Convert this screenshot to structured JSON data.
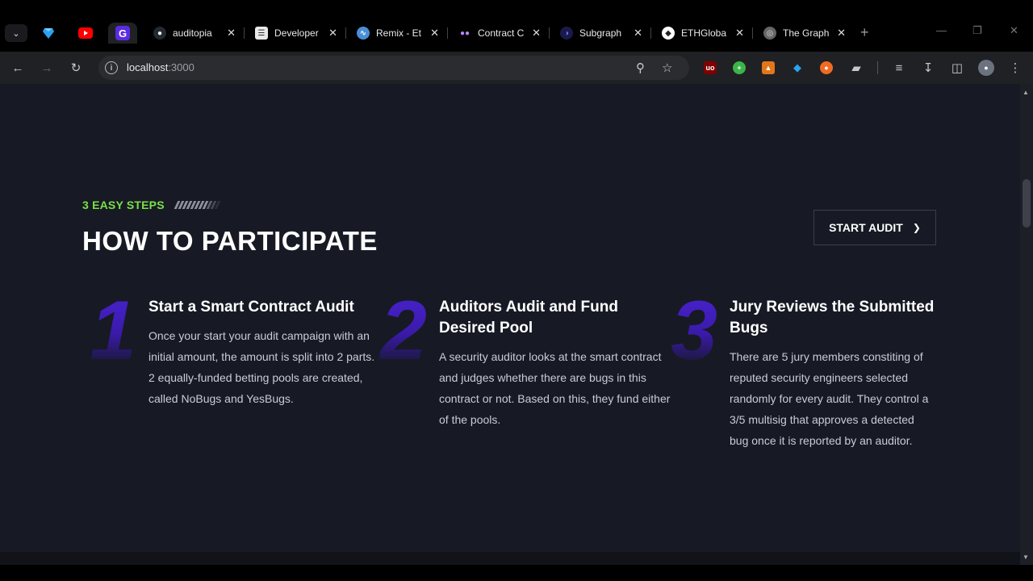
{
  "browser": {
    "tabs": [
      {
        "title": "auditopia",
        "favicon": "github-icon",
        "color": "#24292f"
      },
      {
        "title": "Developer",
        "favicon": "document-icon",
        "color": "#f0f0f0"
      },
      {
        "title": "Remix - Et",
        "favicon": "remix-icon",
        "color": "#4b8ed8"
      },
      {
        "title": "Contract C",
        "favicon": "contract-icon",
        "color": "#b388ff"
      },
      {
        "title": "Subgraph",
        "favicon": "subgraph-icon",
        "color": "#3b2f8f"
      },
      {
        "title": "ETHGloba",
        "favicon": "ethglobal-icon",
        "color": "#ffffff"
      },
      {
        "title": "The Graph",
        "favicon": "globe-icon",
        "color": "#888888"
      }
    ],
    "url_host": "localhost",
    "url_port": ":3000"
  },
  "section": {
    "eyebrow": "3 EASY STEPS",
    "heading": "HOW TO PARTICIPATE",
    "cta_label": "START AUDIT"
  },
  "steps": [
    {
      "number": "1",
      "title": "Start a Smart Contract Audit",
      "description": "Once your start your audit campaign with an initial amount, the amount is split into 2 parts. 2 equally-funded betting pools are created, called NoBugs and YesBugs."
    },
    {
      "number": "2",
      "title": "Auditors Audit and Fund Desired Pool",
      "description": "A security auditor looks at the smart contract and judges whether there are bugs in this contract or not. Based on this, they fund either of the pools."
    },
    {
      "number": "3",
      "title": "Jury Reviews the Submitted Bugs",
      "description": "There are 5 jury members constiting of reputed security engineers selected randomly for every audit. They control a 3/5 multisig that approves a detected bug once it is reported by an auditor."
    }
  ],
  "colors": {
    "accent_green": "#7be046",
    "number_purple": "#4722cc",
    "page_bg": "#171a24"
  }
}
